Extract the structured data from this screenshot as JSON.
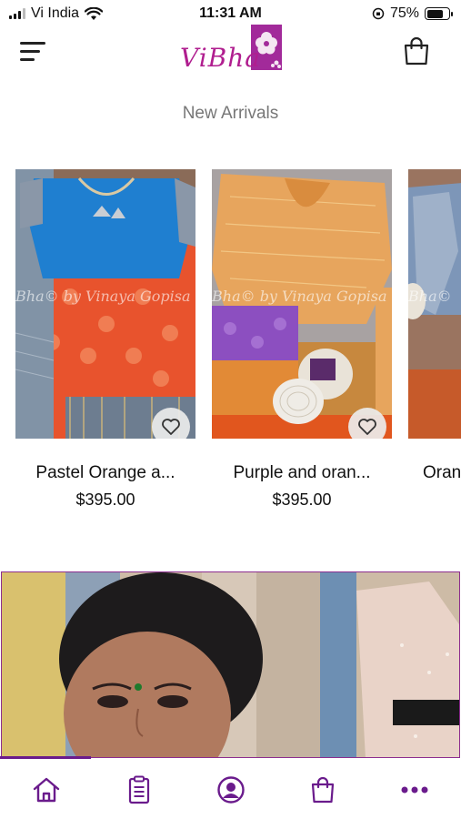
{
  "status_bar": {
    "carrier": "Vi India",
    "time": "11:31 AM",
    "battery": "75%",
    "battery_level": 0.75
  },
  "header": {
    "logo_text": "ViBha",
    "menu_icon": "hamburger-icon",
    "cart_icon": "shopping-bag-icon"
  },
  "section": {
    "title": "New Arrivals"
  },
  "products": [
    {
      "title": "Pastel Orange a...",
      "price": "$395.00",
      "watermark": "Bha© by Vinaya Gopisa"
    },
    {
      "title": "Purple and oran...",
      "price": "$395.00",
      "watermark": "Bha© by Vinaya Gopisa"
    },
    {
      "title": "Oran",
      "price": "",
      "watermark": "Bha©"
    }
  ],
  "bottom_nav": {
    "items": [
      "home-icon",
      "orders-clipboard-icon",
      "account-icon",
      "shopping-bag-icon",
      "more-icon"
    ]
  },
  "colors": {
    "brand": "#6a1b8c",
    "logo": "#b01e8f",
    "section_title": "#777777"
  }
}
